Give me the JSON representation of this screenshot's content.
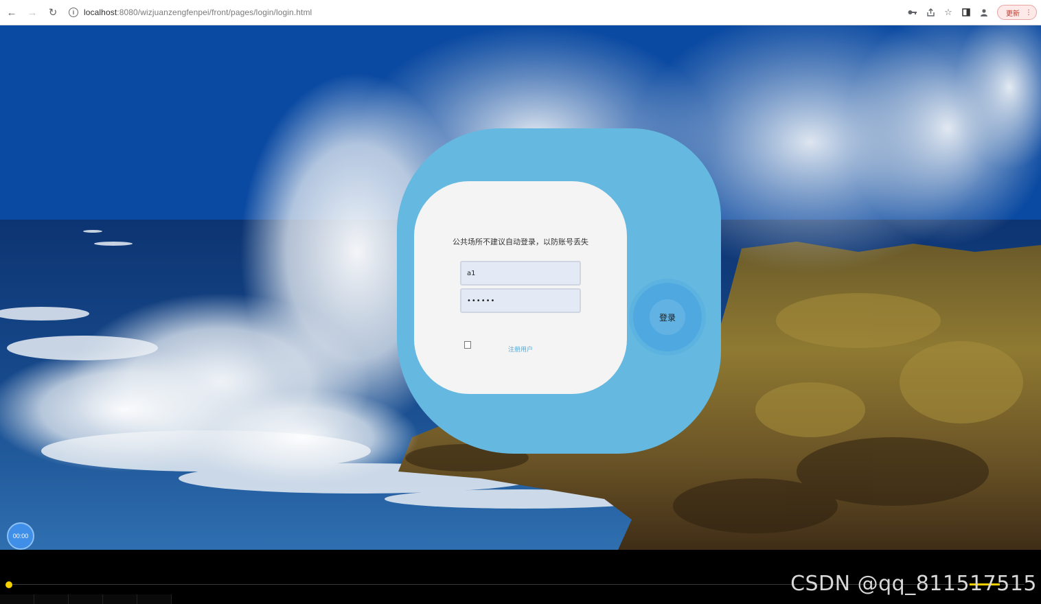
{
  "browser": {
    "url_host": "localhost",
    "url_rest": ":8080/wizjuanzengfenpei/front/pages/login/login.html",
    "update_label": "更新",
    "nav": {
      "back_icon": "arrow-left-icon",
      "forward_icon": "arrow-right-icon",
      "reload_icon": "reload-icon"
    }
  },
  "login": {
    "tip": "公共场所不建议自动登录，以防账号丢失",
    "username_value": "a1",
    "password_value": "••••••",
    "register_label": "注册用户",
    "login_button_label": "登录"
  },
  "player": {
    "timer_text": "00:00",
    "watermark": "CSDN @qq_811517515",
    "progress": 0.0
  },
  "colors": {
    "card_outer": "#65b8e0",
    "card_inner": "#f4f4f5",
    "field_bg": "#e3eaf6",
    "accent_yellow": "#f4d000"
  }
}
